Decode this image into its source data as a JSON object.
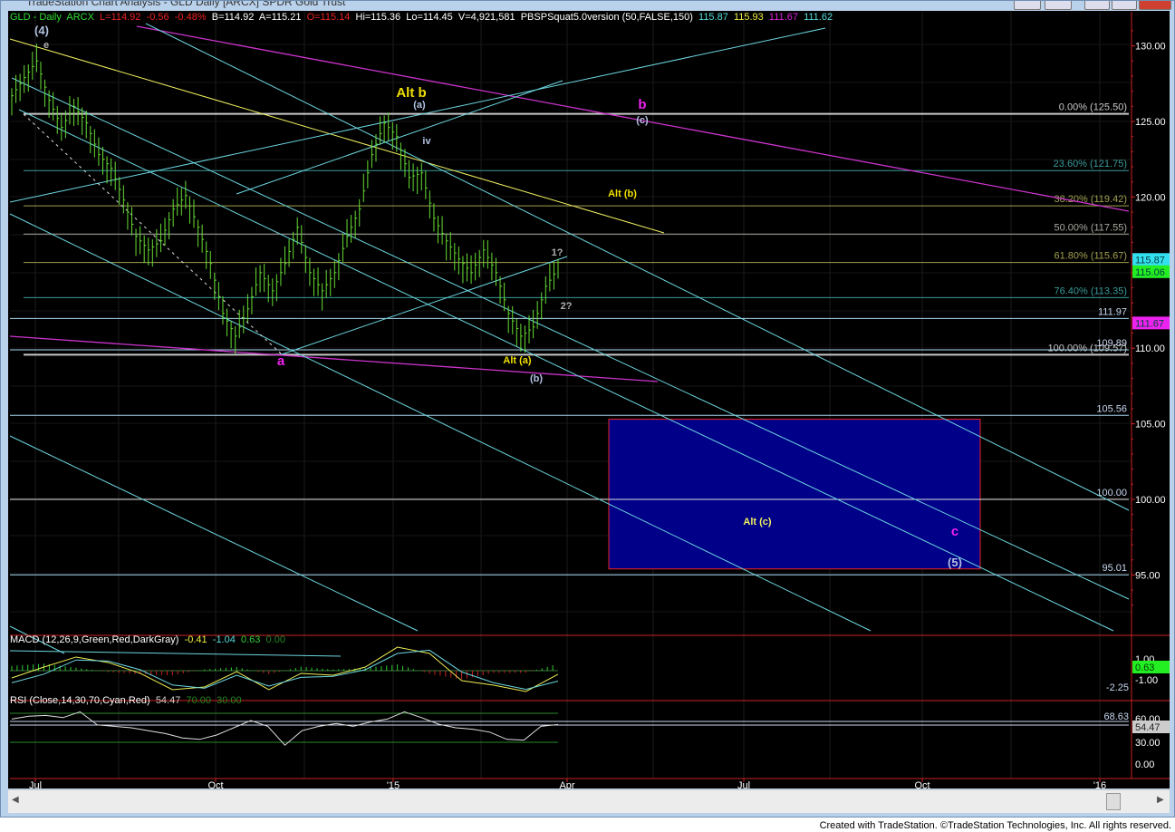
{
  "window": {
    "title": "TradeStation Chart Analysis - GLD Daily [ARCX] SPDR Gold Trust"
  },
  "header": {
    "symbol": "GLD - Daily",
    "exchange": "ARCX",
    "last": "L=114.92",
    "change": "-0.56",
    "pct": "-0.48%",
    "bid": "B=114.92",
    "ask": "A=115.21",
    "open": "O=115.14",
    "high": "Hi=115.36",
    "low": "Lo=114.45",
    "volume": "V=4,921,581",
    "indicator": "PBSPSquat5.0version (50,FALSE,150)",
    "ind_values": [
      "115.87",
      "115.93",
      "111.67",
      "111.62"
    ]
  },
  "colors": {
    "bars": "#66dd33",
    "cyan": "#6cd6e0",
    "magenta": "#cc33cc",
    "yellow": "#f0f060",
    "box": "#000088",
    "axis_red": "#cc2222"
  },
  "chart_data": {
    "type": "line",
    "title": "GLD Daily",
    "price_axis": {
      "ticks": [
        "130.00",
        "125.00",
        "120.00",
        "110.00",
        "105.00",
        "100.00",
        "95.00"
      ],
      "tick_values": [
        130,
        125,
        120,
        110,
        105,
        100,
        95
      ],
      "ylim": [
        91,
        132
      ]
    },
    "date_axis": {
      "ticks": [
        "Jul",
        "Oct",
        "'15",
        "Apr",
        "Jul",
        "Oct",
        "'16"
      ]
    },
    "closes": [
      126.7,
      127.9,
      129.0,
      126.4,
      124.6,
      126.0,
      124.9,
      122.8,
      121.9,
      119.8,
      117.4,
      116.5,
      117.1,
      119.2,
      120.1,
      118.0,
      115.6,
      112.3,
      110.8,
      112.6,
      115.0,
      113.8,
      115.6,
      118.0,
      115.0,
      113.8,
      115.0,
      117.4,
      119.2,
      122.8,
      124.9,
      124.0,
      121.3,
      121.6,
      118.6,
      117.1,
      115.9,
      115.0,
      116.5,
      115.0,
      112.3,
      110.8,
      111.4,
      114.1,
      115.3
    ],
    "fib_levels": [
      {
        "label": "0.00% (125.50)",
        "price": 125.5,
        "color": "#c8c8c8"
      },
      {
        "label": "23.60% (121.75)",
        "price": 121.75,
        "color": "#3a9a9a"
      },
      {
        "label": "38.20% (119.42)",
        "price": 119.42,
        "color": "#a0a050"
      },
      {
        "label": "50.00% (117.55)",
        "price": 117.55,
        "color": "#a8a8a0"
      },
      {
        "label": "61.80% (115.67)",
        "price": 115.67,
        "color": "#a0a050"
      },
      {
        "label": "76.40% (113.35)",
        "price": 113.35,
        "color": "#3a9a9a"
      },
      {
        "label": "100.00% (109.57)",
        "price": 109.57,
        "color": "#c8c8c8"
      }
    ],
    "price_lines": [
      {
        "label": "111.97",
        "price": 111.97
      },
      {
        "label": "109.89",
        "price": 109.89
      },
      {
        "label": "105.56",
        "price": 105.56
      },
      {
        "label": "100.00",
        "price": 100.0
      },
      {
        "label": "95.01",
        "price": 95.01
      }
    ],
    "markers": [
      {
        "label": "115.87",
        "price": 115.87,
        "bg": "#33e0f0"
      },
      {
        "label": "115.06",
        "price": 115.06,
        "bg": "#22ee22"
      },
      {
        "label": "111.67",
        "price": 111.67,
        "bg": "#ee22ee"
      }
    ],
    "target_box": {
      "label": "Alt (c)",
      "high": 105.3,
      "low": 95.4
    },
    "wave_labels": [
      {
        "text": "(4)",
        "color": "#b0c0e0"
      },
      {
        "text": "e",
        "color": "#b0b0b0"
      },
      {
        "text": "Alt b",
        "color": "#f0e000"
      },
      {
        "text": "(a)",
        "color": "#b0c0e0"
      },
      {
        "text": "iv",
        "color": "#b0c0e0"
      },
      {
        "text": "b",
        "color": "#ee22ee"
      },
      {
        "text": "(c)",
        "color": "#b0c0e0"
      },
      {
        "text": "Alt (b)",
        "color": "#f0e000"
      },
      {
        "text": "1?",
        "color": "#b0b0b0"
      },
      {
        "text": "2?",
        "color": "#b0b0b0"
      },
      {
        "text": "a",
        "color": "#ee22ee"
      },
      {
        "text": "Alt (a)",
        "color": "#f0e000"
      },
      {
        "text": "(b)",
        "color": "#b0c0e0"
      },
      {
        "text": "c",
        "color": "#ee22ee"
      },
      {
        "text": "(5)",
        "color": "#b0c0e0"
      }
    ],
    "macd": {
      "title": "MACD (12,26,9,Green,Red,DarkGray)",
      "values_text": [
        "-0.41",
        "-1.04",
        "0.63",
        "0.00"
      ],
      "macd": [
        -0.75,
        0.25,
        1.17,
        0.67,
        -0.33,
        -1.83,
        -1.58,
        -0.17,
        -1.83,
        -0.33,
        -0.5,
        0.25,
        2.08,
        1.5,
        -1.0,
        -1.42,
        -2.0,
        -0.41
      ],
      "signal": [
        -1.2,
        -0.4,
        0.9,
        0.8,
        0.0,
        -1.4,
        -1.7,
        -0.5,
        -1.5,
        -0.7,
        -0.6,
        0.0,
        1.5,
        1.8,
        -0.2,
        -1.2,
        -1.8,
        -1.04
      ],
      "axis": [
        "1.00",
        "-1.00",
        "-2.25"
      ],
      "marker": "0.63"
    },
    "rsi": {
      "title": "RSI (Close,14,30,70,Cyan,Red)",
      "values_text": [
        "54.47",
        "70.00",
        "30.00"
      ],
      "values": [
        62,
        66,
        67,
        64,
        72,
        54,
        52,
        50,
        46,
        42,
        36,
        34,
        40,
        50,
        60,
        52,
        26,
        46,
        52,
        56,
        52,
        58,
        62,
        72,
        64,
        55,
        50,
        48,
        44,
        34,
        33,
        52,
        54.47
      ],
      "axis": [
        "68.63",
        "60.00",
        "30.00",
        "0.00"
      ],
      "marker": "54.47"
    }
  },
  "footer": "Created with TradeStation. ©TradeStation Technologies, Inc. All rights reserved."
}
